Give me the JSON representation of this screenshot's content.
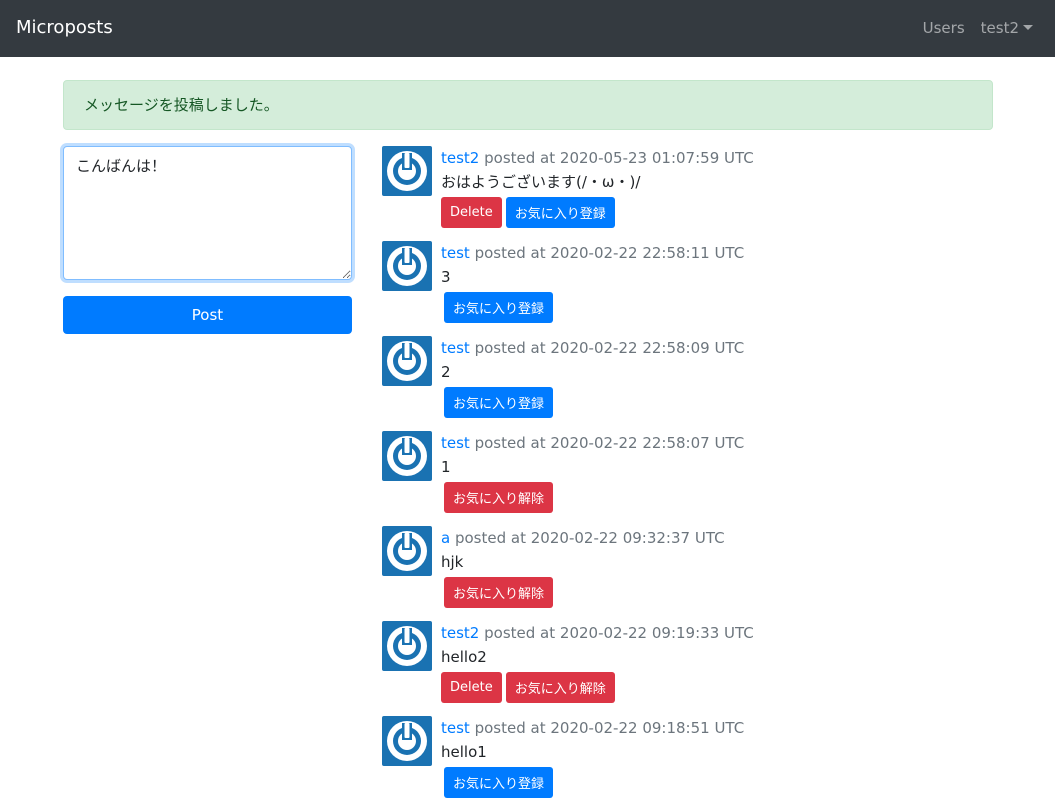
{
  "navbar": {
    "brand": "Microposts",
    "users_link": "Users",
    "account_menu": "test2"
  },
  "alert": {
    "message": "メッセージを投稿しました。"
  },
  "form": {
    "textarea_value": "こんばんは！",
    "post_button": "Post"
  },
  "posted_at_label": "posted at",
  "posts": [
    {
      "user": "test2",
      "timestamp": "2020-05-23 01:07:59 UTC",
      "content": "おはようございます(/・ω・)/",
      "delete_label": "Delete",
      "fav_label": "お気に入り登録",
      "fav_state": "register"
    },
    {
      "user": "test",
      "timestamp": "2020-02-22 22:58:11 UTC",
      "content": "3",
      "delete_label": "",
      "fav_label": "お気に入り登録",
      "fav_state": "register"
    },
    {
      "user": "test",
      "timestamp": "2020-02-22 22:58:09 UTC",
      "content": "2",
      "delete_label": "",
      "fav_label": "お気に入り登録",
      "fav_state": "register"
    },
    {
      "user": "test",
      "timestamp": "2020-02-22 22:58:07 UTC",
      "content": "1",
      "delete_label": "",
      "fav_label": "お気に入り解除",
      "fav_state": "unregister"
    },
    {
      "user": "a",
      "timestamp": "2020-02-22 09:32:37 UTC",
      "content": "hjk",
      "delete_label": "",
      "fav_label": "お気に入り解除",
      "fav_state": "unregister"
    },
    {
      "user": "test2",
      "timestamp": "2020-02-22 09:19:33 UTC",
      "content": "hello2",
      "delete_label": "Delete",
      "fav_label": "お気に入り解除",
      "fav_state": "unregister"
    },
    {
      "user": "test",
      "timestamp": "2020-02-22 09:18:51 UTC",
      "content": "hello1",
      "delete_label": "",
      "fav_label": "お気に入り登録",
      "fav_state": "register"
    }
  ],
  "colors": {
    "navbar_bg": "#343a40",
    "primary": "#007bff",
    "danger": "#dc3545",
    "alert_bg": "#d4edda",
    "alert_text": "#155724",
    "avatar_bg": "#1a72b2"
  }
}
